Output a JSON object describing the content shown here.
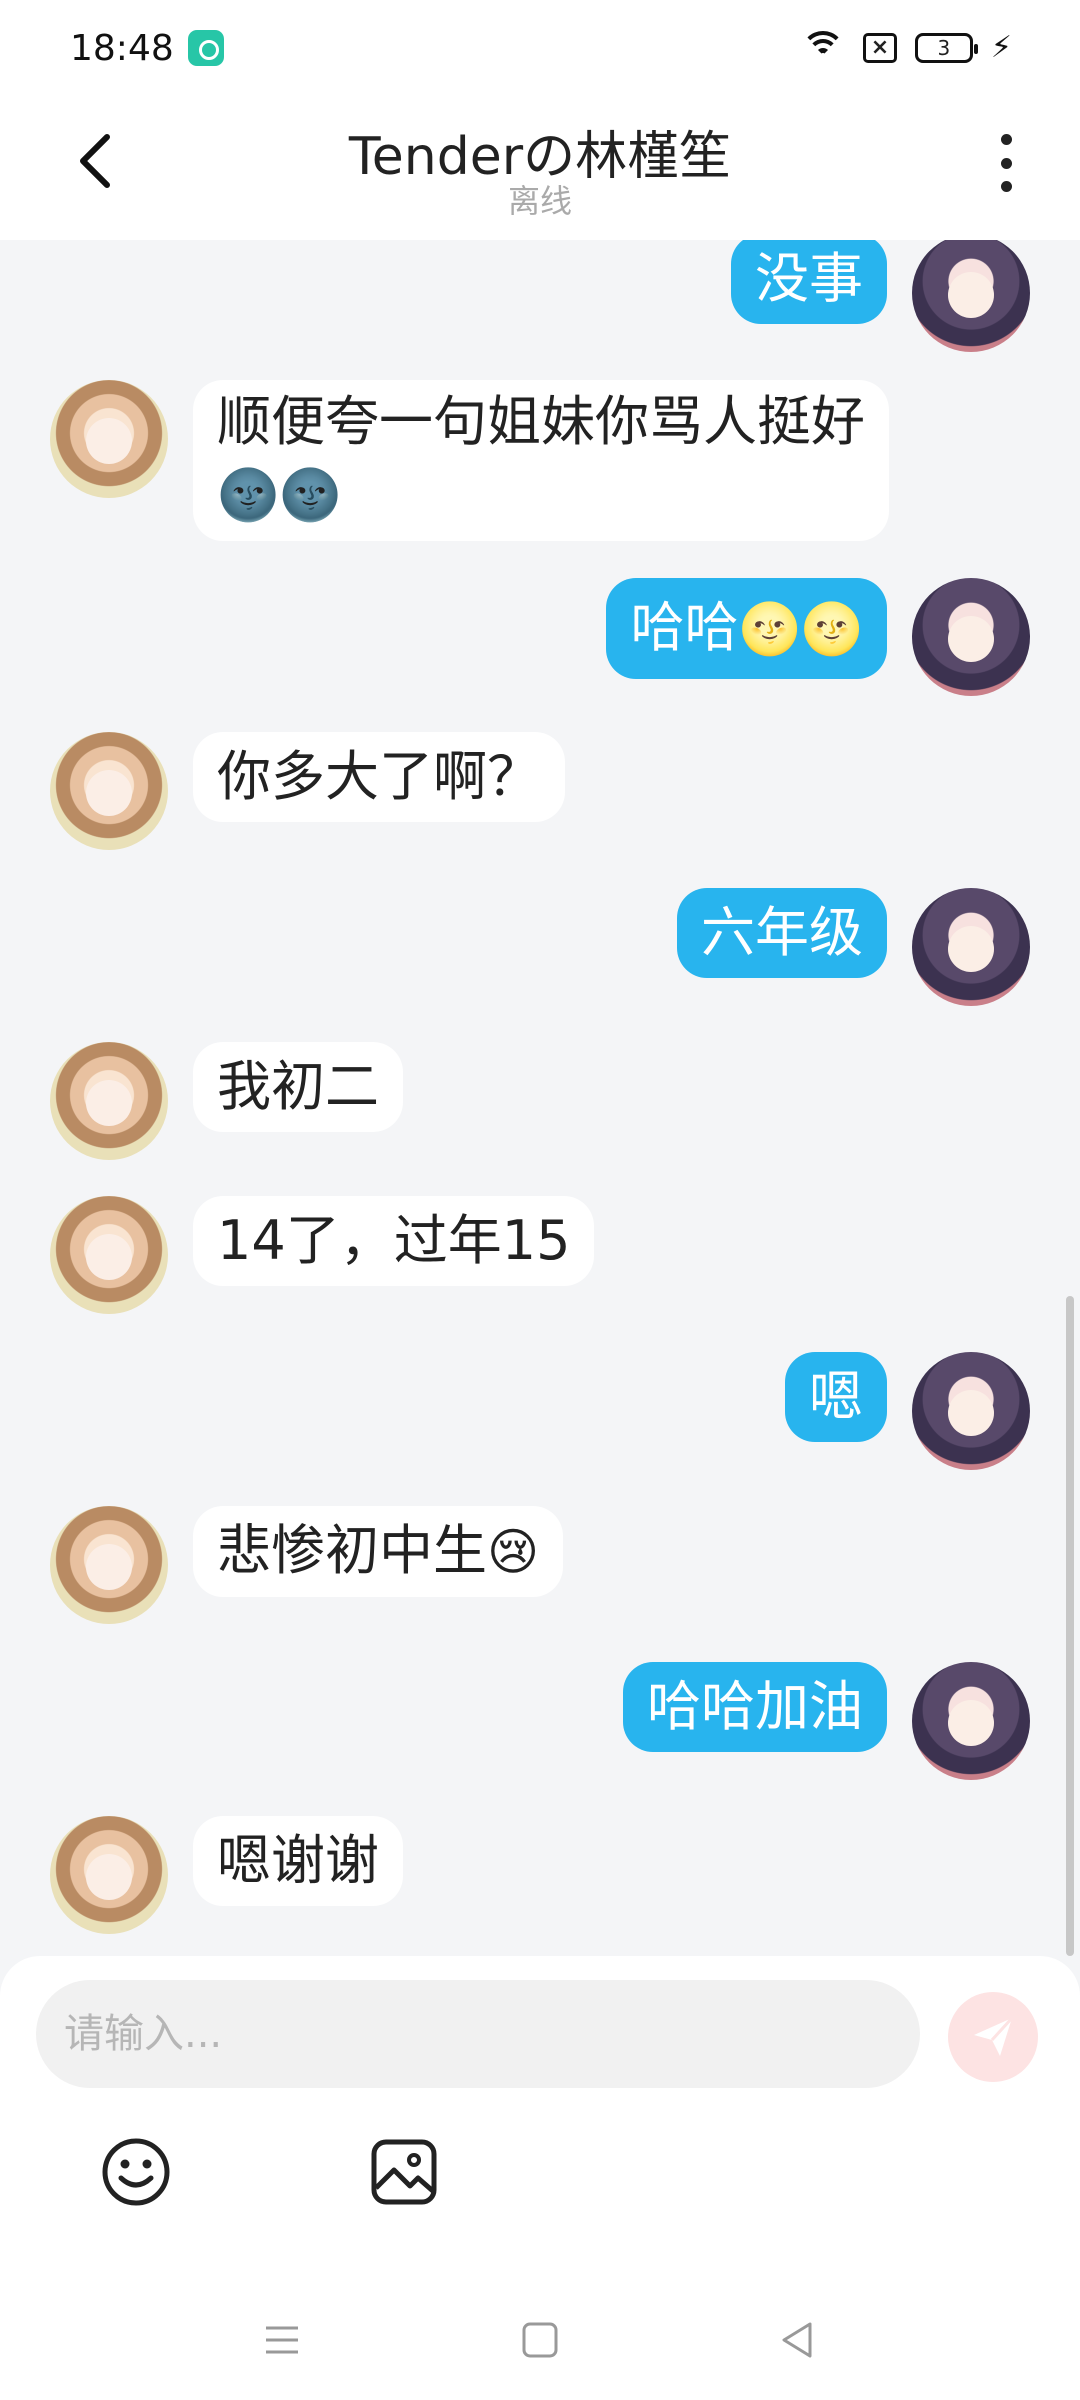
{
  "status_bar": {
    "time": "18:48",
    "battery_level": "3",
    "icons": [
      "app-notification-icon",
      "wifi-icon",
      "no-sim-icon",
      "battery-icon",
      "charging-icon"
    ]
  },
  "header": {
    "title": "Tenderの林槿笙",
    "status": "离线"
  },
  "messages": [
    {
      "from": "me",
      "text": "没事"
    },
    {
      "from": "them",
      "text": "顺便夸一句姐妹你骂人挺好",
      "emoji": "🌚🌚"
    },
    {
      "from": "me",
      "text": "哈哈",
      "emoji": "🌝🌝"
    },
    {
      "from": "them",
      "text": "你多大了啊？"
    },
    {
      "from": "me",
      "text": "六年级"
    },
    {
      "from": "them",
      "text": "我初二"
    },
    {
      "from": "them",
      "text": "14了，过年15"
    },
    {
      "from": "me",
      "text": "嗯"
    },
    {
      "from": "them",
      "text": "悲惨初中生",
      "emoji": "😢"
    },
    {
      "from": "me",
      "text": "哈哈加油"
    },
    {
      "from": "them",
      "text": "嗯谢谢"
    }
  ],
  "input": {
    "placeholder": "请输入..."
  },
  "colors": {
    "outgoing_bubble": "#28b4ee",
    "incoming_bubble": "#ffffff",
    "chat_background": "#f4f5f7",
    "send_button": "#fde3e3"
  }
}
